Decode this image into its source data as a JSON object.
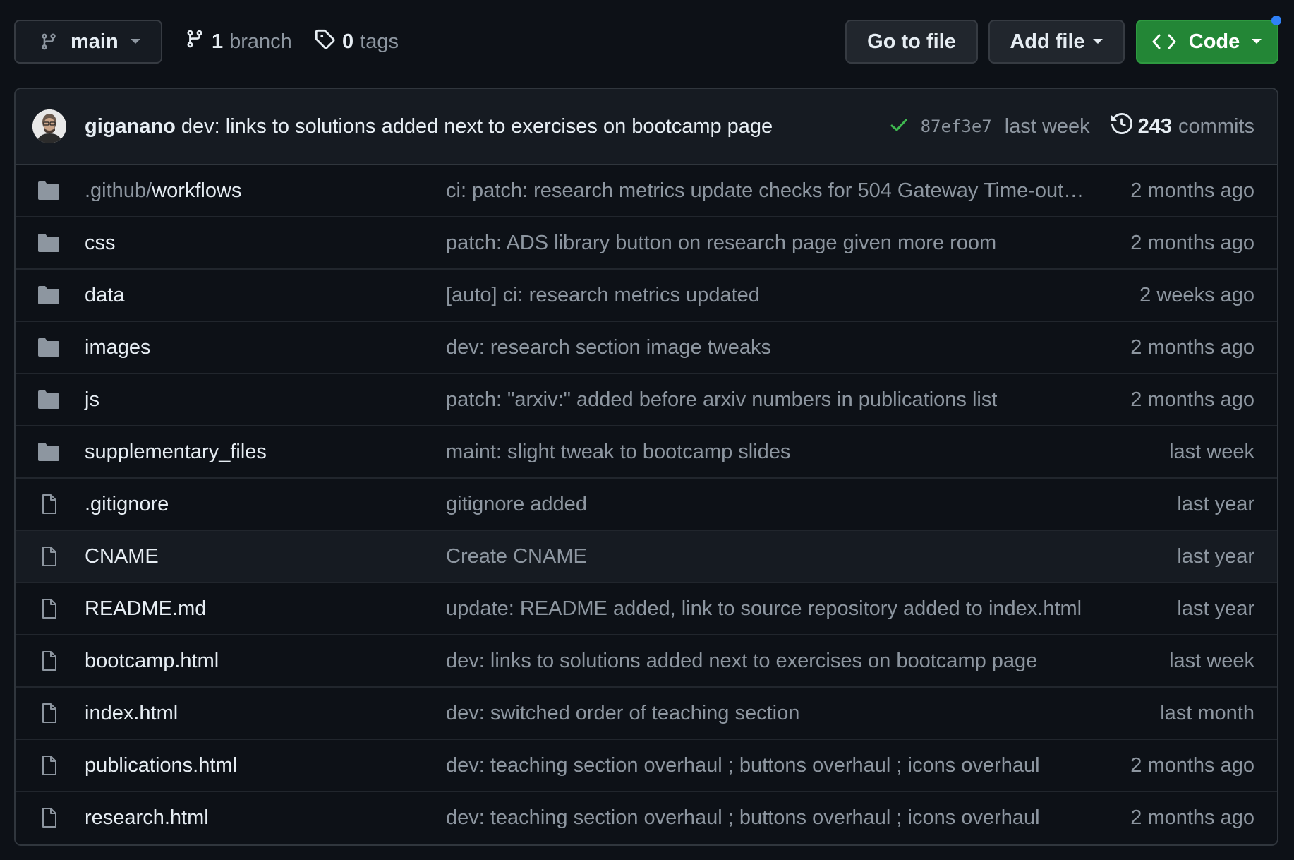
{
  "toolbar": {
    "branch_name": "main",
    "branches_count": "1",
    "branches_label": "branch",
    "tags_count": "0",
    "tags_label": "tags",
    "go_to_file_label": "Go to file",
    "add_file_label": "Add file",
    "code_label": "Code"
  },
  "latest_commit": {
    "author": "giganano",
    "message": "dev: links to solutions added next to exercises on bootcamp page",
    "status": "success",
    "sha": "87ef3e7",
    "time": "last week",
    "commits_count": "243",
    "commits_label": "commits"
  },
  "colors": {
    "background": "#0d1117",
    "code_button": "#238636",
    "check": "#3fb950",
    "notification_dot": "#2f81f7",
    "muted_text": "#8d96a0"
  },
  "files": [
    {
      "type": "folder",
      "prefix": ".github/",
      "name": "workflows",
      "message": "ci: patch: research metrics update checks for 504 Gateway Time-out…",
      "time": "2 months ago"
    },
    {
      "type": "folder",
      "prefix": "",
      "name": "css",
      "message": "patch: ADS library button on research page given more room",
      "time": "2 months ago"
    },
    {
      "type": "folder",
      "prefix": "",
      "name": "data",
      "message": "[auto] ci: research metrics updated",
      "time": "2 weeks ago"
    },
    {
      "type": "folder",
      "prefix": "",
      "name": "images",
      "message": "dev: research section image tweaks",
      "time": "2 months ago"
    },
    {
      "type": "folder",
      "prefix": "",
      "name": "js",
      "message": "patch: \"arxiv:\" added before arxiv numbers in publications list",
      "time": "2 months ago"
    },
    {
      "type": "folder",
      "prefix": "",
      "name": "supplementary_files",
      "message": "maint: slight tweak to bootcamp slides",
      "time": "last week"
    },
    {
      "type": "file",
      "prefix": "",
      "name": ".gitignore",
      "message": "gitignore added",
      "time": "last year"
    },
    {
      "type": "file",
      "prefix": "",
      "name": "CNAME",
      "message": "Create CNAME",
      "time": "last year"
    },
    {
      "type": "file",
      "prefix": "",
      "name": "README.md",
      "message": "update: README added, link to source repository added to index.html",
      "time": "last year"
    },
    {
      "type": "file",
      "prefix": "",
      "name": "bootcamp.html",
      "message": "dev: links to solutions added next to exercises on bootcamp page",
      "time": "last week"
    },
    {
      "type": "file",
      "prefix": "",
      "name": "index.html",
      "message": "dev: switched order of teaching section",
      "time": "last month"
    },
    {
      "type": "file",
      "prefix": "",
      "name": "publications.html",
      "message": "dev: teaching section overhaul ; buttons overhaul ; icons overhaul",
      "time": "2 months ago"
    },
    {
      "type": "file",
      "prefix": "",
      "name": "research.html",
      "message": "dev: teaching section overhaul ; buttons overhaul ; icons overhaul",
      "time": "2 months ago"
    }
  ]
}
